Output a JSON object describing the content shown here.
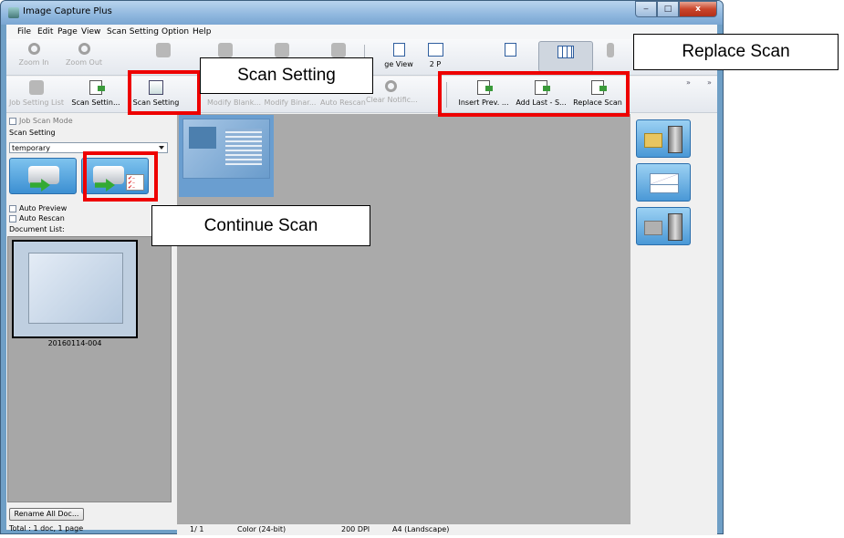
{
  "window": {
    "title": "Image Capture Plus",
    "buttons": {
      "minimize": "‒",
      "maximize": "□",
      "close": "x"
    }
  },
  "menu": [
    "File",
    "Edit",
    "Page",
    "View",
    "Scan Setting",
    "Option",
    "Help"
  ],
  "toolbar1": {
    "zoom_in": "Zoom In",
    "zoom_out": "Zoom Out",
    "page_view": "ge View",
    "two_page_view": "2 P"
  },
  "toolbar2": {
    "job_setting_list": "Job Setting List",
    "scan_settings": "Scan Settin...",
    "scan_setting": "Scan Setting",
    "modify_blank": "Modify Blank...",
    "modify_binar": "Modify Binar...",
    "auto_rescan": "Auto Rescan",
    "clear_notific": "Clear Notific...",
    "insert_prev": "Insert Prev. ...",
    "add_last": "Add Last - S...",
    "replace_scan": "Replace Scan",
    "more": "»"
  },
  "left_panel": {
    "job_scan_mode": "Job Scan Mode",
    "scan_setting_label": "Scan Setting",
    "scan_setting_value": "temporary",
    "auto_preview": "Auto Preview",
    "auto_rescan": "Auto Rescan",
    "document_list_label": "Document List:",
    "document_name": "20160114-004",
    "rename_all": "Rename All Doc...",
    "total": "Total :  1 doc,   1 page"
  },
  "status": {
    "page": "1/  1",
    "color": "Color (24-bit)",
    "dpi": "200 DPI",
    "paper": "A4 (Landscape)"
  },
  "annotations": {
    "replace_scan": "Replace Scan",
    "scan_setting": "Scan Setting",
    "continue_scan": "Continue Scan"
  },
  "colors": {
    "highlight": "#ee0000",
    "accent": "#3c8fd2"
  }
}
